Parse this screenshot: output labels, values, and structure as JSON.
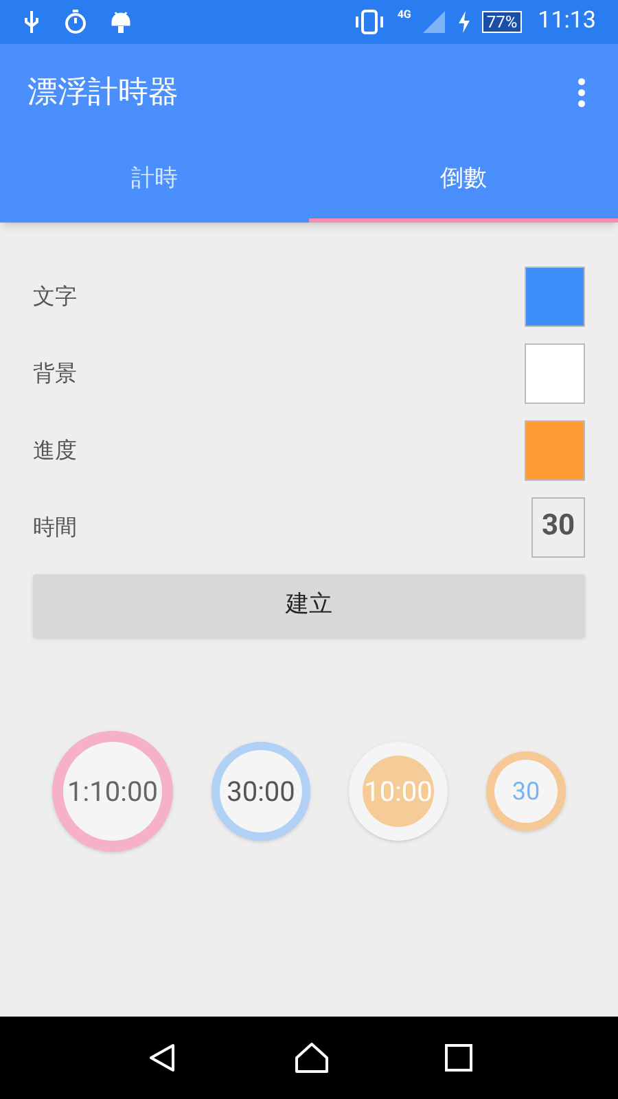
{
  "status_bar": {
    "network": "4G",
    "battery": "77%",
    "time": "11:13"
  },
  "app_bar": {
    "title": "漂浮計時器"
  },
  "tabs": [
    {
      "label": "計時",
      "selected": false
    },
    {
      "label": "倒數",
      "selected": true
    }
  ],
  "settings": [
    {
      "kind": "color",
      "label": "文字",
      "color": "#3d8ef8"
    },
    {
      "kind": "color",
      "label": "背景",
      "color": "#ffffff"
    },
    {
      "kind": "color",
      "label": "進度",
      "color": "#ff9c33"
    },
    {
      "kind": "number",
      "label": "時間",
      "value": "30"
    }
  ],
  "create_button": "建立",
  "timers": [
    {
      "ring": {
        "color": "#f6b0c8"
      },
      "face": {
        "color": "#f5f5f5"
      },
      "label": {
        "text": "1:10:00",
        "color": "#666666"
      }
    },
    {
      "ring": {
        "color": "#b0d0f5"
      },
      "face": {
        "color": "#f5f5f5"
      },
      "label": {
        "text": "30:00",
        "color": "#555555"
      }
    },
    {
      "ring": {
        "color": "#f5f5f5"
      },
      "face": {
        "color": "#f5cc98"
      },
      "label": {
        "text": "10:00",
        "color": "#ffffff"
      }
    },
    {
      "ring": {
        "color": "#f5c896"
      },
      "face": {
        "color": "#f5f5f5"
      },
      "label": {
        "text": "30",
        "color": "#7ab3f0"
      }
    }
  ]
}
